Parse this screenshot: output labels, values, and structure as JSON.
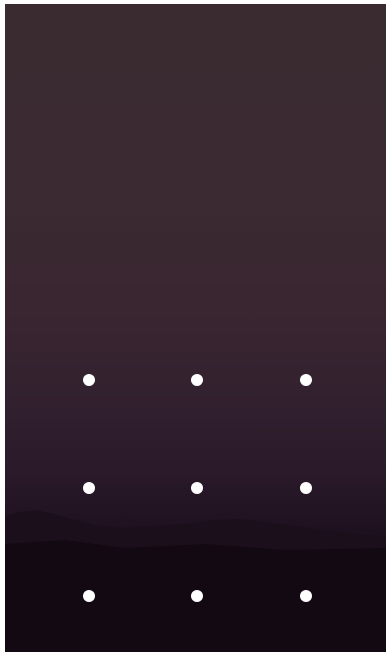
{
  "lock_screen": {
    "type": "pattern-unlock",
    "rows": 3,
    "columns": 3,
    "dot_color": "#ffffff",
    "wallpaper": "dusk-mountain-silhouette"
  }
}
